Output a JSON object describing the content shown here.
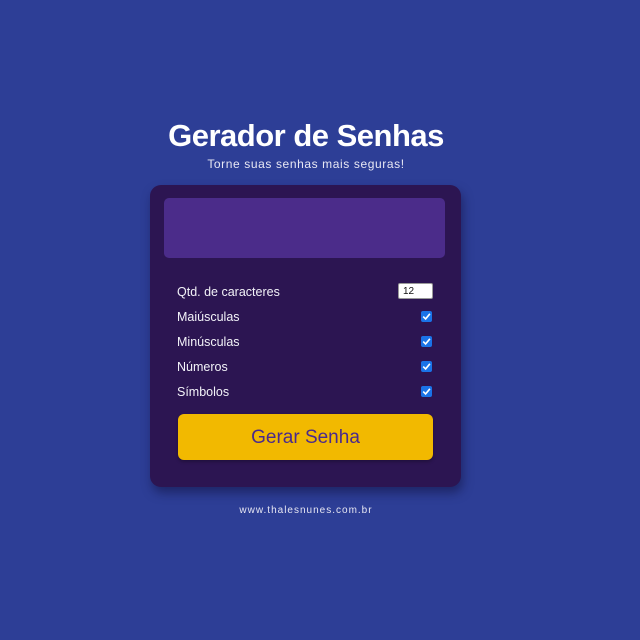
{
  "header": {
    "title": "Gerador de Senhas",
    "subtitle": "Torne suas senhas mais seguras!"
  },
  "generator": {
    "password_value": "",
    "length_label": "Qtd. de caracteres",
    "length_value": "12",
    "options": [
      {
        "label": "Maiúsculas",
        "checked": true
      },
      {
        "label": "Minúsculas",
        "checked": true
      },
      {
        "label": "Números",
        "checked": true
      },
      {
        "label": "Símbolos",
        "checked": true
      }
    ],
    "button_label": "Gerar Senha"
  },
  "footer": {
    "link_text": "www.thalesnunes.com.br"
  },
  "colors": {
    "background": "#2d3e96",
    "card": "#2c1552",
    "display": "#4b2c8a",
    "button": "#f2b900",
    "button_text": "#4a2a8c",
    "checkbox": "#1a73e8"
  }
}
